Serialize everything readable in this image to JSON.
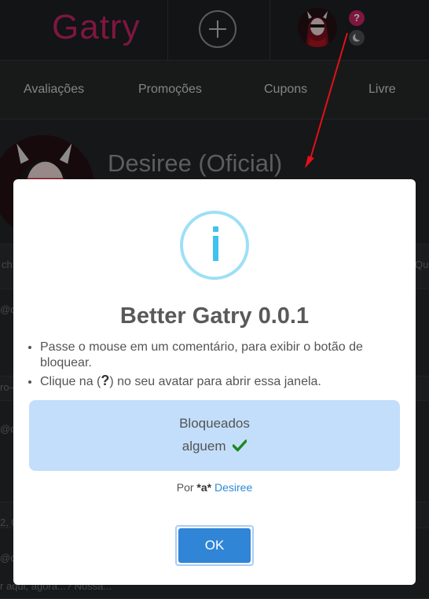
{
  "header": {
    "logo": "Gatry",
    "help_badge": "?",
    "icons": [
      "plus-icon",
      "avatar",
      "help-icon",
      "moon-icon"
    ]
  },
  "nav": {
    "items": [
      "Avaliações",
      "Promoções",
      "Cupons",
      "Livre"
    ]
  },
  "profile": {
    "name": "Desiree (Oficial)"
  },
  "background_text": {
    "row1_left": "ch",
    "row1_right": "Qu",
    "row2": "@de",
    "row3": "ro-c",
    "row4": "@de",
    "row5": "2, 0",
    "row6": "@de",
    "row7": "r aqui, agora...? Nossa..."
  },
  "modal": {
    "title": "Better Gatry 0.0.1",
    "bullet1": "Passe o mouse em um comentário, para exibir o botão de bloquear.",
    "bullet2_before": "Clique na (",
    "bullet2_icon": "?",
    "bullet2_after": ") no seu avatar para abrir essa janela.",
    "blocked_title": "Bloqueados",
    "blocked_user": "alguem",
    "credit_prefix": "Por ",
    "credit_handle": "*a*",
    "credit_link": "Desiree",
    "ok_label": "OK"
  },
  "colors": {
    "brand": "#c0245e",
    "info": "#3fc3ee",
    "blocked_bg": "#c3defb",
    "ok_button": "#3085d6",
    "link": "#2d8ad7",
    "check": "#1a8a1a",
    "arrow": "#e3101a"
  }
}
